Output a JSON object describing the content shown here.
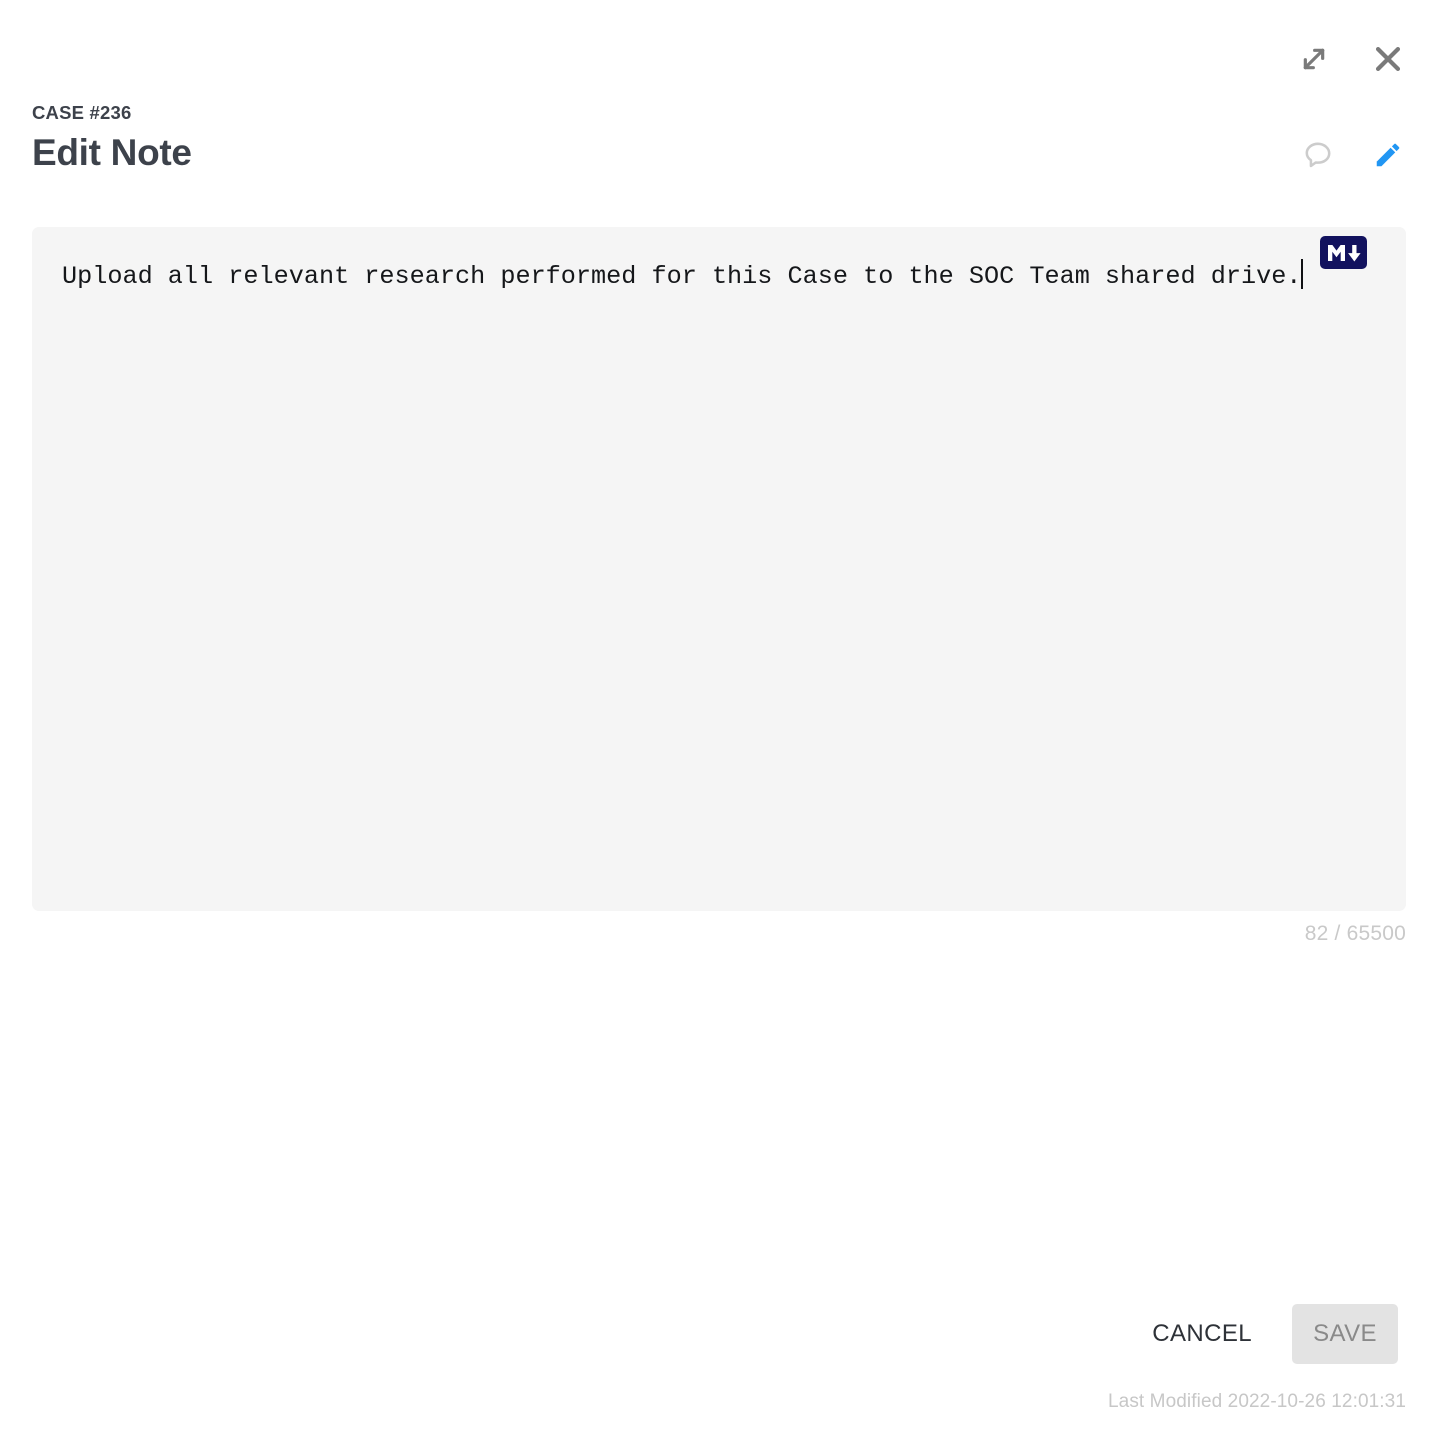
{
  "dialog": {
    "case_label": "CASE #236",
    "title": "Edit Note"
  },
  "window_controls": {
    "expand_icon": "expand-icon",
    "close_icon": "close-icon"
  },
  "header_actions": {
    "comment_icon": "comment-icon",
    "edit_icon": "pencil-icon"
  },
  "editor": {
    "value": "Upload all relevant research performed for this Case to the SOC Team shared drive.",
    "placeholder": "",
    "markdown_badge": "markdown-icon",
    "char_counter": "82 / 65500",
    "char_count": 82,
    "char_max": 65500
  },
  "footer": {
    "cancel_label": "CANCEL",
    "save_label": "SAVE",
    "save_disabled": true,
    "last_modified": "Last Modified 2022-10-26 12:01:31"
  },
  "colors": {
    "accent_blue": "#2196f3",
    "text_dark": "#3d424b",
    "editor_bg": "#f5f5f5",
    "muted": "#c9c9c9",
    "markdown_navy": "#12125e",
    "save_bg": "#e3e3e3"
  }
}
